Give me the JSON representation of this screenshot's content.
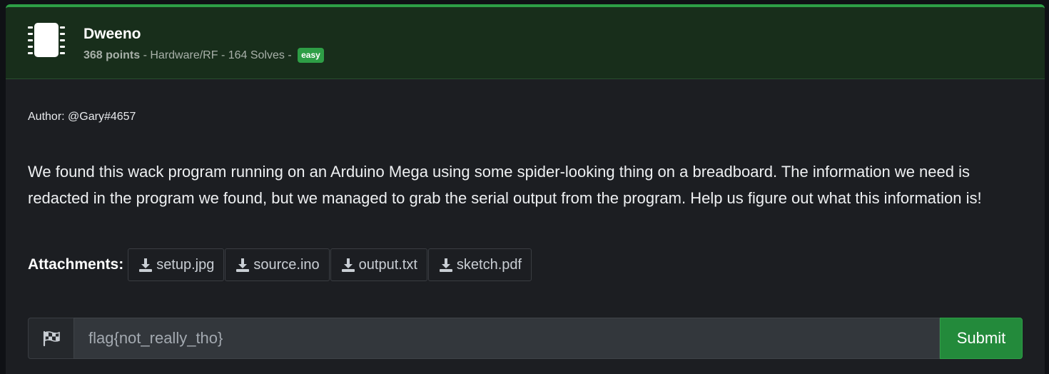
{
  "challenge": {
    "icon": "microchip-icon",
    "title": "Dweeno",
    "points": "368 points",
    "meta_rest": " - Hardware/RF - 164 Solves - ",
    "difficulty": "easy",
    "author": "Author: @Gary#4657",
    "description": "We found this wack program running on an Arduino Mega using some spider-looking thing on a breadboard. The information we need is redacted in the program we found, but we managed to grab the serial output from the program. Help us figure out what this information is!"
  },
  "attachments": {
    "label": "Attachments:",
    "icon": "download-icon",
    "files": [
      "setup.jpg",
      "source.ino",
      "output.txt",
      "sketch.pdf"
    ]
  },
  "flag_form": {
    "icon": "checkered-flag-icon",
    "placeholder": "flag{not_really_tho}",
    "submit_label": "Submit"
  },
  "colors": {
    "accent": "#2e9e46",
    "header_bg": "#182e1b",
    "card_bg": "#1c1e22"
  }
}
